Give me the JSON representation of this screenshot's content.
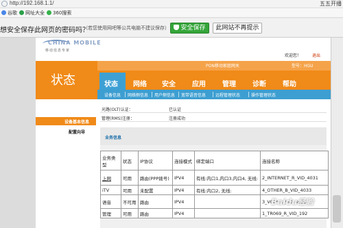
{
  "browser": {
    "url": "http://192.168.1.1/",
    "right_label": "五五开播",
    "favorites": [
      "谷歌",
      "网址大全",
      "360搜索"
    ]
  },
  "password_bar": {
    "question": "想安全保存此网页的密码吗？",
    "note": "（若您使用网吧等公共电脑不建议保存）",
    "save_label": "安全保存",
    "never_label": "此网站不再提示"
  },
  "header": {
    "brand": "CHINA MOBILE",
    "brand_sub": "移动信息专家",
    "welcome": "欢迎您！",
    "exit": "退出",
    "model": "PON移动家庭网关",
    "model_type": "型号：HGU",
    "section_title": "状态"
  },
  "menu": {
    "tabs": [
      "状态",
      "网络",
      "安全",
      "应用",
      "管理",
      "诊断",
      "帮助"
    ],
    "active": "状态"
  },
  "submenu": [
    "设备信息",
    "网络侧信息",
    "用户侧信息",
    "宽带语音信息",
    "远程管理状态",
    "操作管理状态"
  ],
  "sidebar": {
    "active": "设备基本信息",
    "items": [
      "配置向导"
    ]
  },
  "info_rows": [
    {
      "key": "光路(OLT)认证：",
      "value": "已认证"
    },
    {
      "key": "管理(RMS)注册：",
      "value": "注册成功"
    }
  ],
  "service": {
    "title": "业务信息",
    "columns": [
      "业务类型",
      "状态",
      "IP协议",
      "连接模式",
      "绑定端口",
      "连接名称"
    ],
    "rows": [
      [
        "上网",
        "可用",
        "路由(PPP拨号)",
        "IPV4",
        "有线:内口1,内口3,内口4, 无线:",
        "2_INTERNET_R_VID_4031"
      ],
      [
        "iTV",
        "可用",
        "未配置",
        "IPV4",
        "有线:内口2, 无线:",
        "4_OTHER_B_VID_4033"
      ],
      [
        "语音",
        "不可用",
        "路由",
        "IPV4",
        "",
        "3_VOIP_R_VID_4032"
      ],
      [
        "管理",
        "可用",
        "路由",
        "IPV4",
        "",
        "1_TR069_R_VID_192"
      ]
    ]
  },
  "watermark": "Baidu经验"
}
